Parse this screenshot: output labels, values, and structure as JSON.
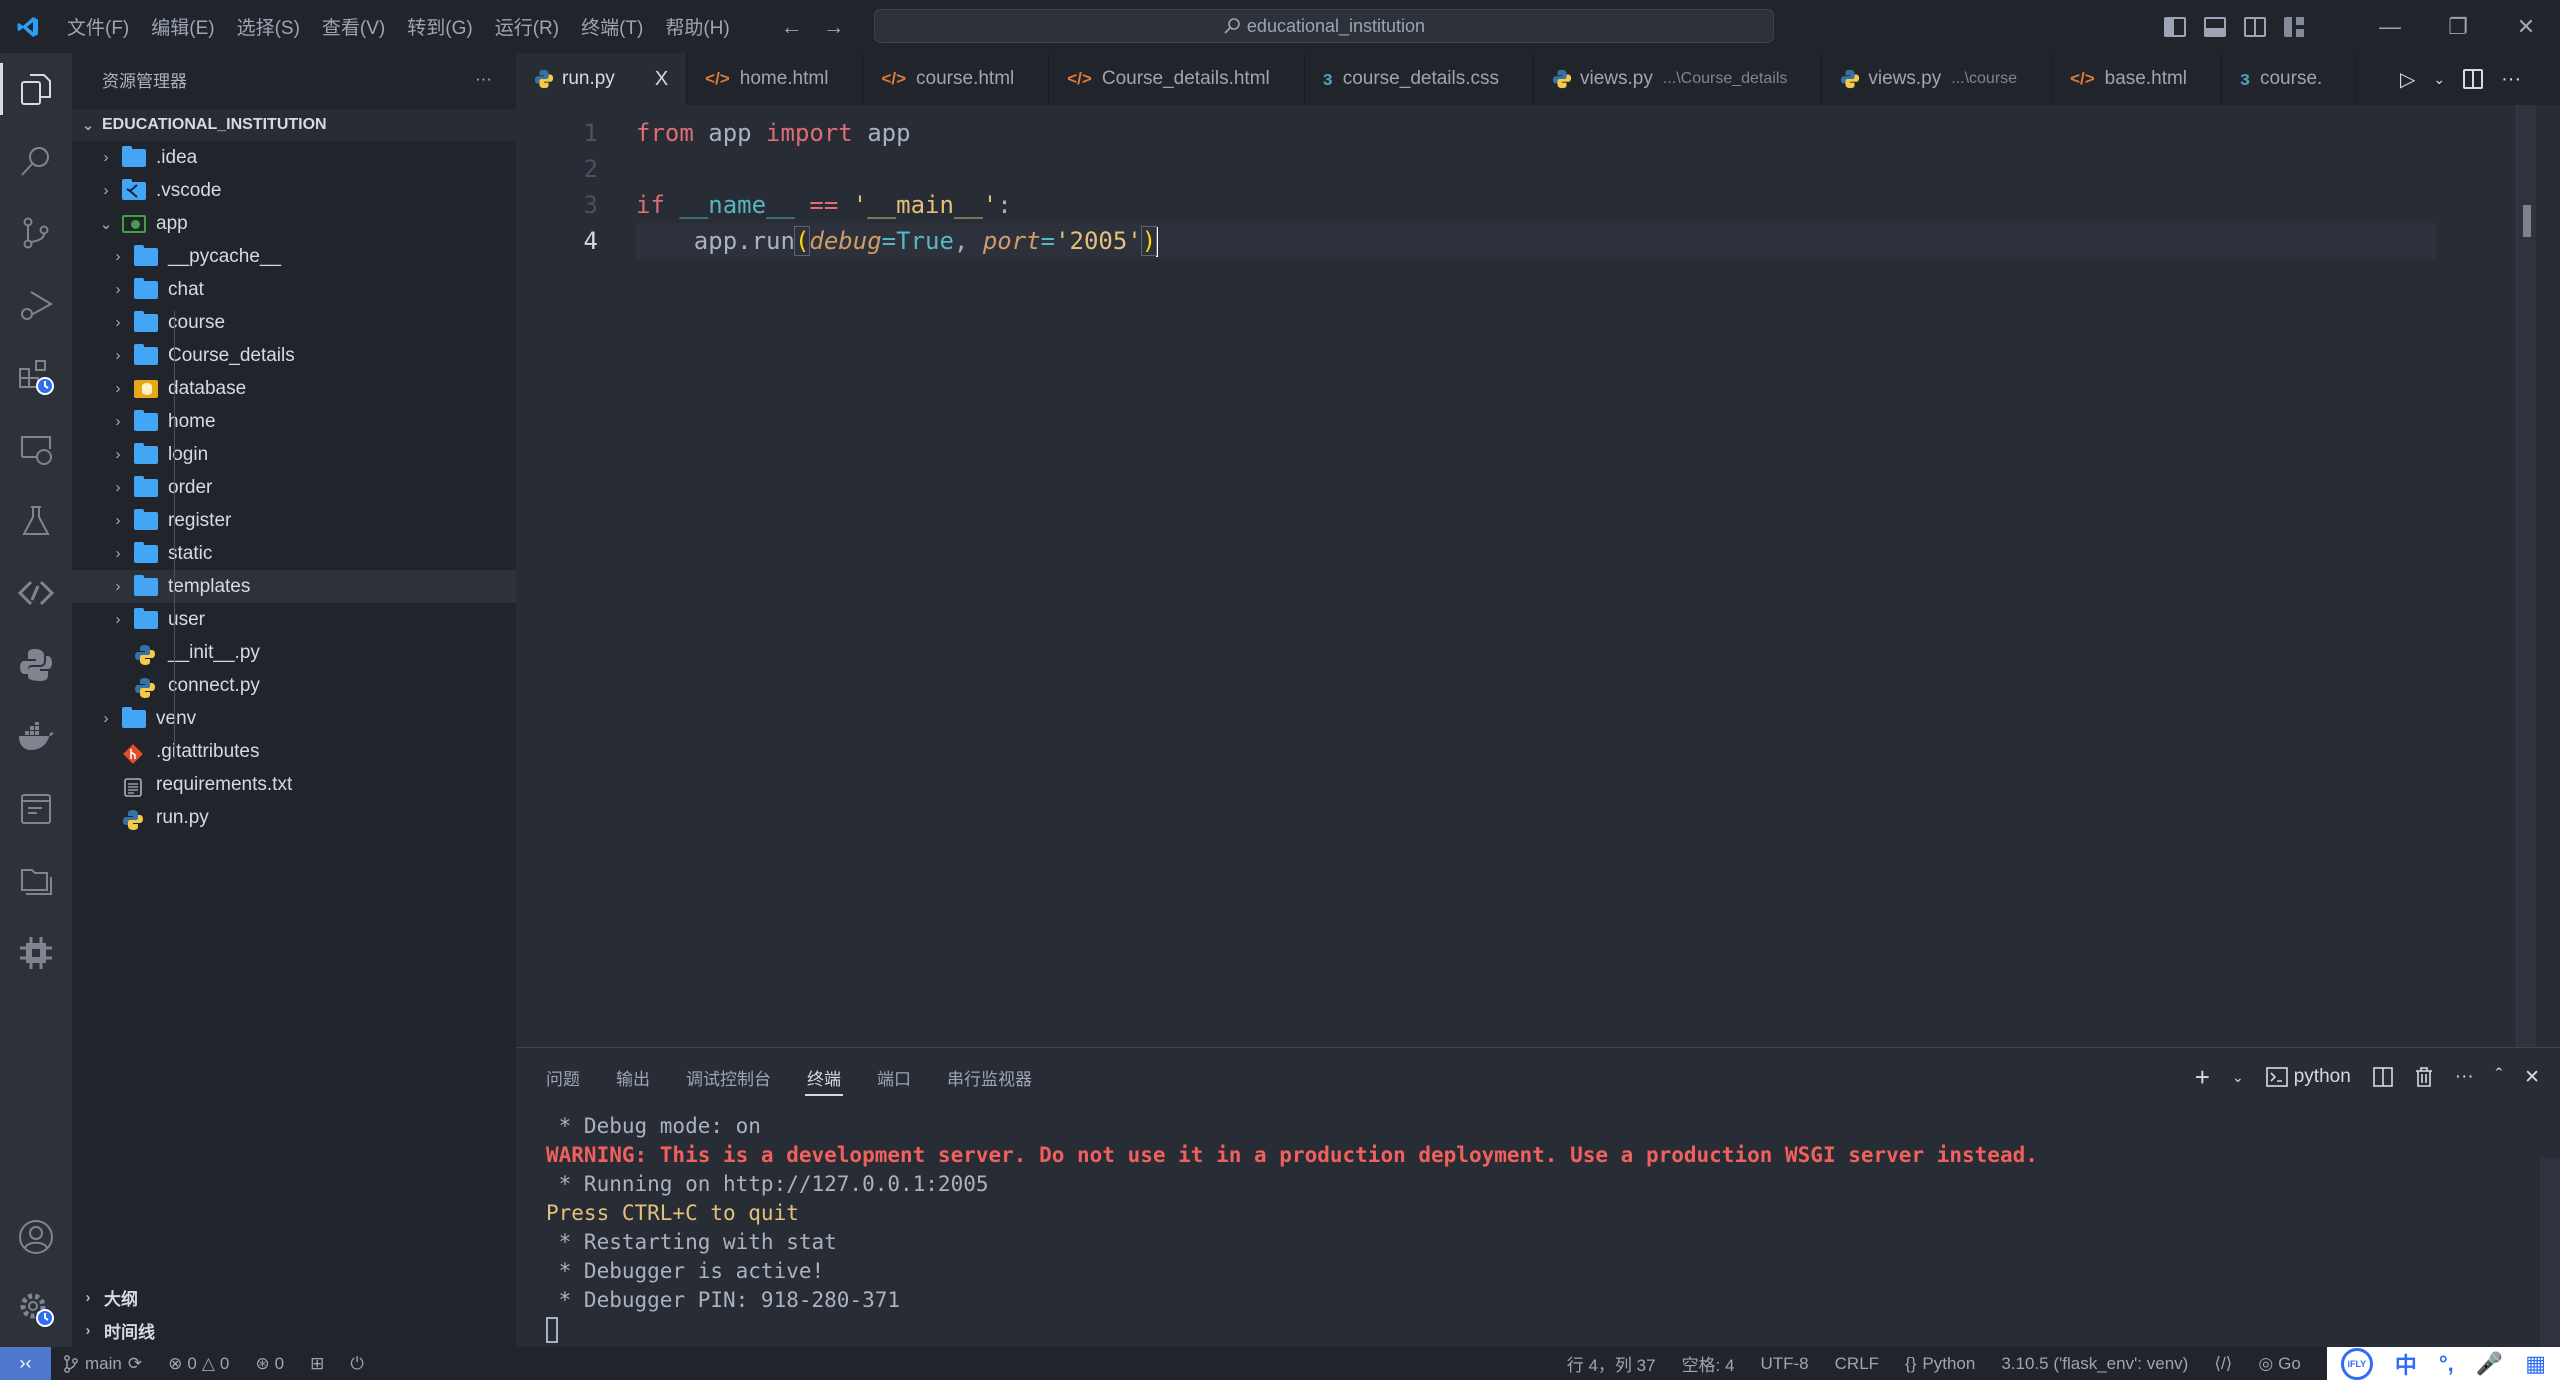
{
  "window": {
    "search_text": "educational_institution",
    "menu": [
      "文件(F)",
      "编辑(E)",
      "选择(S)",
      "查看(V)",
      "转到(G)",
      "运行(R)",
      "终端(T)",
      "帮助(H)"
    ]
  },
  "activity_bar": {
    "items": [
      "explorer",
      "search",
      "source-control",
      "run-debug",
      "extensions",
      "remote-explorer",
      "testing",
      "live-share",
      "python",
      "docker",
      "notebook",
      "folder",
      "chip"
    ],
    "bottom": [
      "accounts",
      "manage"
    ]
  },
  "sidebar": {
    "title": "资源管理器",
    "more": "···",
    "root": "EDUCATIONAL_INSTITUTION",
    "tree": [
      {
        "label": ".idea",
        "type": "folder",
        "depth": 0,
        "expanded": false
      },
      {
        "label": ".vscode",
        "type": "vscode-folder",
        "depth": 0,
        "expanded": false
      },
      {
        "label": "app",
        "type": "app-folder",
        "depth": 0,
        "expanded": true
      },
      {
        "label": "__pycache__",
        "type": "folder",
        "depth": 1,
        "expanded": false
      },
      {
        "label": "chat",
        "type": "folder",
        "depth": 1,
        "expanded": false
      },
      {
        "label": "course",
        "type": "folder",
        "depth": 1,
        "expanded": false
      },
      {
        "label": "Course_details",
        "type": "folder",
        "depth": 1,
        "expanded": false
      },
      {
        "label": "database",
        "type": "db-folder",
        "depth": 1,
        "expanded": false
      },
      {
        "label": "home",
        "type": "folder",
        "depth": 1,
        "expanded": false
      },
      {
        "label": "login",
        "type": "folder",
        "depth": 1,
        "expanded": false
      },
      {
        "label": "order",
        "type": "folder",
        "depth": 1,
        "expanded": false
      },
      {
        "label": "register",
        "type": "folder",
        "depth": 1,
        "expanded": false
      },
      {
        "label": "static",
        "type": "folder",
        "depth": 1,
        "expanded": false
      },
      {
        "label": "templates",
        "type": "folder",
        "depth": 1,
        "expanded": false,
        "hover": true
      },
      {
        "label": "user",
        "type": "folder",
        "depth": 1,
        "expanded": false
      },
      {
        "label": "__init__.py",
        "type": "python",
        "depth": 1
      },
      {
        "label": "connect.py",
        "type": "python",
        "depth": 1
      },
      {
        "label": "venv",
        "type": "folder",
        "depth": 0,
        "expanded": false
      },
      {
        "label": ".gitattributes",
        "type": "git",
        "depth": 0
      },
      {
        "label": "requirements.txt",
        "type": "text",
        "depth": 0
      },
      {
        "label": "run.py",
        "type": "python",
        "depth": 0
      }
    ],
    "sections": [
      "大纲",
      "时间线"
    ]
  },
  "tabs": [
    {
      "label": "run.py",
      "icon": "python",
      "active": true,
      "close": "X"
    },
    {
      "label": "home.html",
      "icon": "html"
    },
    {
      "label": "course.html",
      "icon": "html"
    },
    {
      "label": "Course_details.html",
      "icon": "html"
    },
    {
      "label": "course_details.css",
      "icon": "css"
    },
    {
      "label": "views.py",
      "icon": "python",
      "desc": "...\\Course_details"
    },
    {
      "label": "views.py",
      "icon": "python",
      "desc": "...\\course"
    },
    {
      "label": "base.html",
      "icon": "html"
    },
    {
      "label": "course.",
      "icon": "css"
    }
  ],
  "editor": {
    "line_numbers": [
      "1",
      "2",
      "3",
      "4"
    ],
    "current_line": 4,
    "lines": [
      [
        {
          "t": "from",
          "c": "kw"
        },
        {
          "t": " app ",
          "c": "id"
        },
        {
          "t": "import",
          "c": "kw"
        },
        {
          "t": " app",
          "c": "id"
        }
      ],
      [],
      [
        {
          "t": "if",
          "c": "kw"
        },
        {
          "t": " ",
          "c": "id"
        },
        {
          "t": "__name__",
          "c": "dn"
        },
        {
          "t": " ",
          "c": "id"
        },
        {
          "t": "==",
          "c": "kw"
        },
        {
          "t": " ",
          "c": "id"
        },
        {
          "t": "'__main__'",
          "c": "st"
        },
        {
          "t": ":",
          "c": "id"
        }
      ],
      [
        {
          "t": "    app.run",
          "c": "id"
        },
        {
          "t": "(",
          "c": "bm"
        },
        {
          "t": "debug",
          "c": "pa"
        },
        {
          "t": "=",
          "c": "op"
        },
        {
          "t": "True",
          "c": "bool"
        },
        {
          "t": ", ",
          "c": "id"
        },
        {
          "t": "port",
          "c": "pa"
        },
        {
          "t": "=",
          "c": "op"
        },
        {
          "t": "'2005'",
          "c": "st"
        },
        {
          "t": ")",
          "c": "bm"
        }
      ]
    ]
  },
  "panel": {
    "tabs": [
      "问题",
      "输出",
      "调试控制台",
      "终端",
      "端口",
      "串行监视器"
    ],
    "active_tab": "终端",
    "terminal_name": "python",
    "terminal_lines": [
      {
        "text": " * Debug mode: on",
        "style": "t-n"
      },
      {
        "text": "WARNING: This is a development server. Do not use it in a production deployment. Use a production WSGI server instead.",
        "style": "t-w"
      },
      {
        "text": " * Running on http://127.0.0.1:2005",
        "style": "t-n"
      },
      {
        "text": "Press CTRL+C to quit",
        "style": "t-y"
      },
      {
        "text": " * Restarting with stat",
        "style": "t-n"
      },
      {
        "text": " * Debugger is active!",
        "style": "t-n"
      },
      {
        "text": " * Debugger PIN: 918-280-371",
        "style": "t-n"
      }
    ]
  },
  "statusbar": {
    "branch": "main",
    "errors": "0",
    "warnings": "0",
    "ports": "0",
    "position": "行 4，列 37",
    "spaces": "空格: 4",
    "encoding": "UTF-8",
    "eol": "CRLF",
    "language": "Python",
    "interpreter": "3.10.5 ('flask_env': venv)",
    "go_live": "Go",
    "ime": {
      "badge": "iFLY",
      "lang": "中",
      "punct": "°,"
    }
  },
  "colors": {
    "accent": "#4d78cc",
    "folder": "#42a5f5",
    "warning_text": "#f0605d",
    "keyword": "#e06c75",
    "string": "#e5c07b"
  }
}
